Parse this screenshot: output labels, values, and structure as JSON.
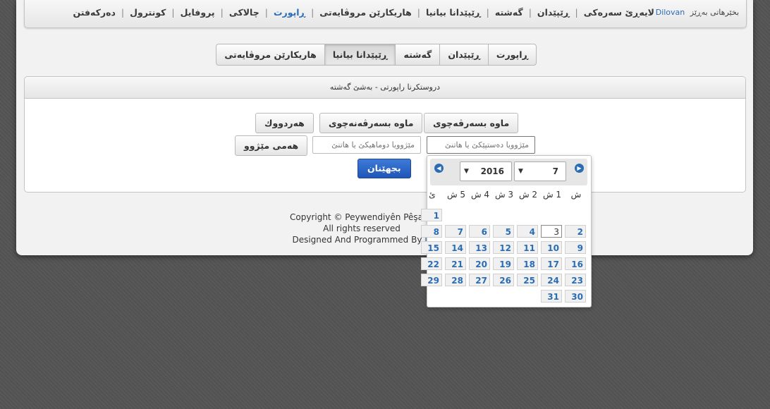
{
  "header": {
    "welcome_prefix": "بخێرهاتی بەڕێز",
    "username": "Dilovan",
    "nav": [
      {
        "label": "لایەڕێ سەرەکی",
        "active": false
      },
      {
        "label": "ڕێپێدان",
        "active": false
      },
      {
        "label": "گەشتە",
        "active": false
      },
      {
        "label": "ڕێپێدانا بیانیا",
        "active": false
      },
      {
        "label": "هاریکارێن مروڤایەتی",
        "active": false
      },
      {
        "label": "ڕاپورت",
        "active": true
      },
      {
        "label": "چالاکی",
        "active": false
      },
      {
        "label": "پروفایل",
        "active": false
      },
      {
        "label": "کونترول",
        "active": false
      },
      {
        "label": "دەرکەفتن",
        "active": false
      }
    ]
  },
  "tabs": [
    {
      "label": "ڕاپورت",
      "active": false
    },
    {
      "label": "ڕێپێدان",
      "active": false
    },
    {
      "label": "گەشتە",
      "active": false
    },
    {
      "label": "ڕێپێدانا بیانیا",
      "active": true
    },
    {
      "label": "هاریکارێن مروڤایەتی",
      "active": false
    }
  ],
  "panel": {
    "title": "دروستکرنا راپورتی - بەشێ گەشتە",
    "buttons": {
      "valid": "ماوە بسەرڤەچوی",
      "expired": "ماوە بسەرڤەنەچوی",
      "both": "هەردووك",
      "all_dates": "هەمی مێژوو"
    },
    "start_placeholder": "مێژوویا دەستپێکێ یا هاتنێ",
    "end_placeholder": "مێژوویا دوماهیکێ یا هاتنێ",
    "submit": "بجهێنان"
  },
  "footer": {
    "line1": "Copyright © Peywendiyên Pêşabo",
    "line2": "All rights reserved",
    "line3_prefix": "Designed And Programmed By",
    "line3_brand": "D"
  },
  "datepicker": {
    "month": "7",
    "year": "2016",
    "weekdays": [
      "ش",
      "1 ش",
      "2 ش",
      "3 ش",
      "4 ش",
      "5 ش",
      "ئ"
    ],
    "today": 3,
    "rows": [
      [
        null,
        null,
        null,
        null,
        null,
        null,
        1
      ],
      [
        2,
        3,
        4,
        5,
        6,
        7,
        8
      ],
      [
        9,
        10,
        11,
        12,
        13,
        14,
        15
      ],
      [
        16,
        17,
        18,
        19,
        20,
        21,
        22
      ],
      [
        23,
        24,
        25,
        26,
        27,
        28,
        29
      ],
      [
        30,
        31,
        null,
        null,
        null,
        null,
        null
      ]
    ]
  },
  "colors": {
    "accent": "#2a6db5",
    "primary_button": "#2962c6",
    "background": "#545454",
    "page": "#f2f2f2"
  }
}
